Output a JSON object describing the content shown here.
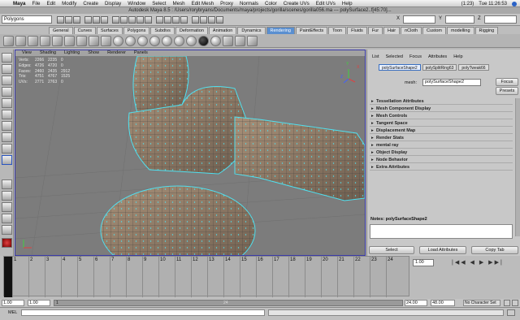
{
  "mac_menu": {
    "app": "Maya",
    "items": [
      "File",
      "Edit",
      "Modify",
      "Create",
      "Display",
      "Window",
      "Select",
      "Mesh",
      "Edit Mesh",
      "Proxy",
      "Normals",
      "Color",
      "Create UVs",
      "Edit UVs",
      "Help"
    ],
    "battery": "(1:23)",
    "clock": "Tue 11:26:53"
  },
  "window_title": "Autodesk Maya 8.5 : /Users/rorybryans/Documents/maya/projects/gorilla/scenes/gorilla056.ma  ---  polySurface2..f[45:70]...",
  "status_line": {
    "menu_set": "Polygons",
    "x_label": "X",
    "y_label": "Y",
    "z_label": "Z"
  },
  "shelf_tabs": [
    "General",
    "Curves",
    "Surfaces",
    "Polygons",
    "Subdivs",
    "Deformation",
    "Animation",
    "Dynamics",
    "Rendering",
    "PaintEffects",
    "Toon",
    "Fluids",
    "Fur",
    "Hair",
    "nCloth",
    "Custom",
    "modelling",
    "Rigging"
  ],
  "shelf_active_tab": "Rendering",
  "viewport": {
    "menu": [
      "View",
      "Shading",
      "Lighting",
      "Show",
      "Renderer",
      "Panels"
    ],
    "hud": [
      {
        "label": "Verts:",
        "a": "2266",
        "b": "2235",
        "c": "0"
      },
      {
        "label": "Edges:",
        "a": "4726",
        "b": "4720",
        "c": "0"
      },
      {
        "label": "Faces:",
        "a": "2460",
        "b": "2435",
        "c": "2912"
      },
      {
        "label": "Tris:",
        "a": "4751",
        "b": "4767",
        "c": "1525"
      },
      {
        "label": "UVs:",
        "a": "2771",
        "b": "2763",
        "c": "0"
      }
    ],
    "axis_x": "X",
    "axis_y": "Y",
    "axis_z": "Z"
  },
  "attribute_editor": {
    "menu": [
      "List",
      "Selected",
      "Focus",
      "Attributes",
      "Help"
    ],
    "tabs": [
      "polySurfaceShape2",
      "polySplitRing63",
      "polyTweak66"
    ],
    "active_tab": "polySurfaceShape2",
    "mesh_label": "mesh:",
    "mesh_value": "polySurfaceShape2",
    "focus_btn": "Focus",
    "presets_btn": "Presets",
    "sections": [
      "Tessellation Attributes",
      "Mesh Component Display",
      "Mesh Controls",
      "Tangent Space",
      "Displacement Map",
      "Render Stats",
      "mental ray",
      "Object Display",
      "Node Behavior",
      "Extra Attributes"
    ],
    "notes_label": "Notes:  polySurfaceShape2",
    "select_btn": "Select",
    "load_btn": "Load Attributes",
    "copy_btn": "Copy Tab"
  },
  "time_slider": {
    "frames": [
      "1",
      "2",
      "3",
      "4",
      "5",
      "6",
      "7",
      "8",
      "9",
      "10",
      "11",
      "12",
      "13",
      "14",
      "15",
      "16",
      "17",
      "18",
      "19",
      "20",
      "21",
      "22",
      "23",
      "24"
    ],
    "current_frame": "1.00"
  },
  "range_slider": {
    "start": "1.00",
    "playback_start": "1.00",
    "range_start": "1",
    "range_end": "24",
    "playback_end": "24.00",
    "end": "48.00",
    "char_set": "No Character Set"
  },
  "command_line": {
    "label": "MEL"
  }
}
